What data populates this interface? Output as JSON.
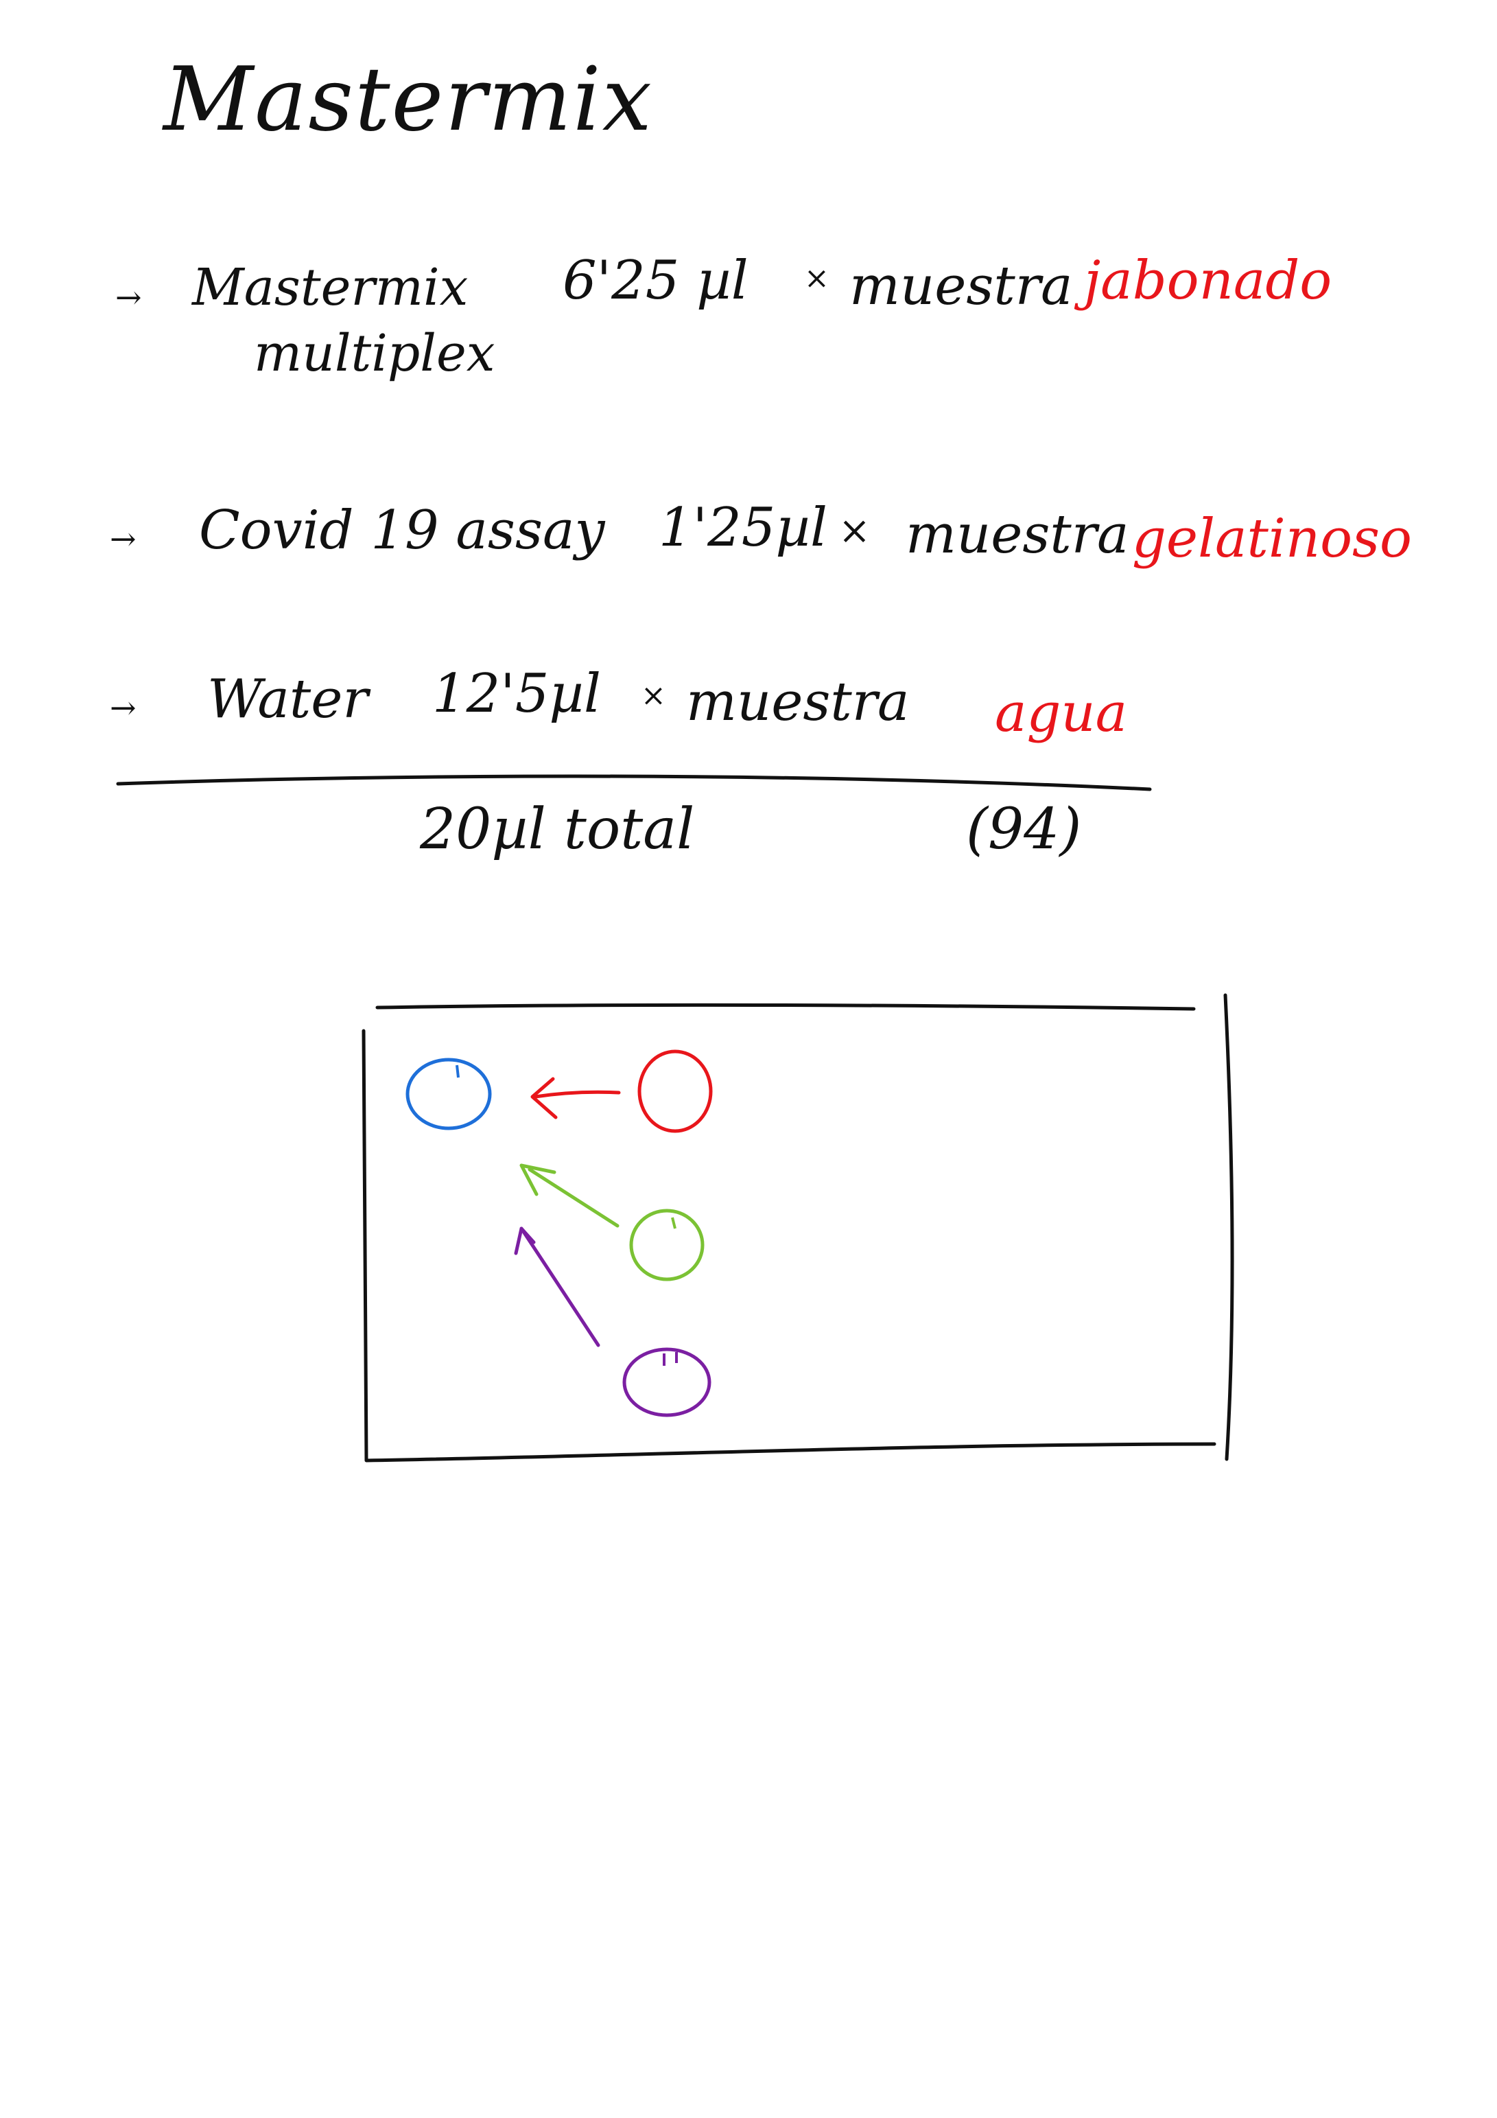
{
  "title": "Mastermix",
  "items": [
    {
      "label_line1": "Mastermix",
      "label_line2": "multiplex",
      "amount": "6'25 µl",
      "times": "×",
      "per": "muestra",
      "note": "jabonado"
    },
    {
      "label_line1": "Covid 19 assay",
      "amount": "1'25µl",
      "times": "×",
      "per": "muestra",
      "note": "gelatinoso"
    },
    {
      "label_line1": "Water",
      "amount": "12'5µl",
      "times": "×",
      "per": "muestra",
      "note": "agua"
    }
  ],
  "total": {
    "text": "20µl total",
    "count": "(94)"
  },
  "diagram": {
    "circle_colors": {
      "blue": "#1e6fd9",
      "red": "#e8161b",
      "green": "#7bc234",
      "purple": "#7b1fa2"
    }
  },
  "colors": {
    "ink": "#111111",
    "accent": "#e8161b"
  }
}
